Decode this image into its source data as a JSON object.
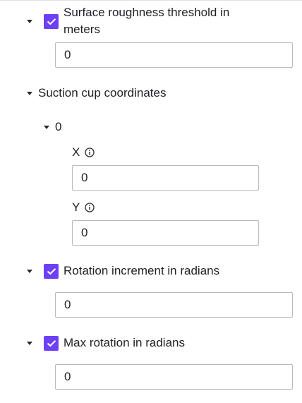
{
  "fields": {
    "surface_roughness": {
      "label": "Surface roughness threshold in meters",
      "value": "0",
      "checked": true
    },
    "suction_cup": {
      "label": "Suction cup coordinates",
      "item_index": "0",
      "x": {
        "label": "X",
        "value": "0"
      },
      "y": {
        "label": "Y",
        "value": "0"
      }
    },
    "rotation_increment": {
      "label": "Rotation increment in radians",
      "value": "0",
      "checked": true
    },
    "max_rotation": {
      "label": "Max rotation in radians",
      "value": "0",
      "checked": true
    }
  },
  "colors": {
    "accent": "#6d3ff5",
    "border": "#b9b9c0",
    "text": "#1f1f24"
  },
  "icons": {
    "expand": "caret-down-icon",
    "check": "checkmark-icon",
    "info": "info-circle-icon"
  }
}
